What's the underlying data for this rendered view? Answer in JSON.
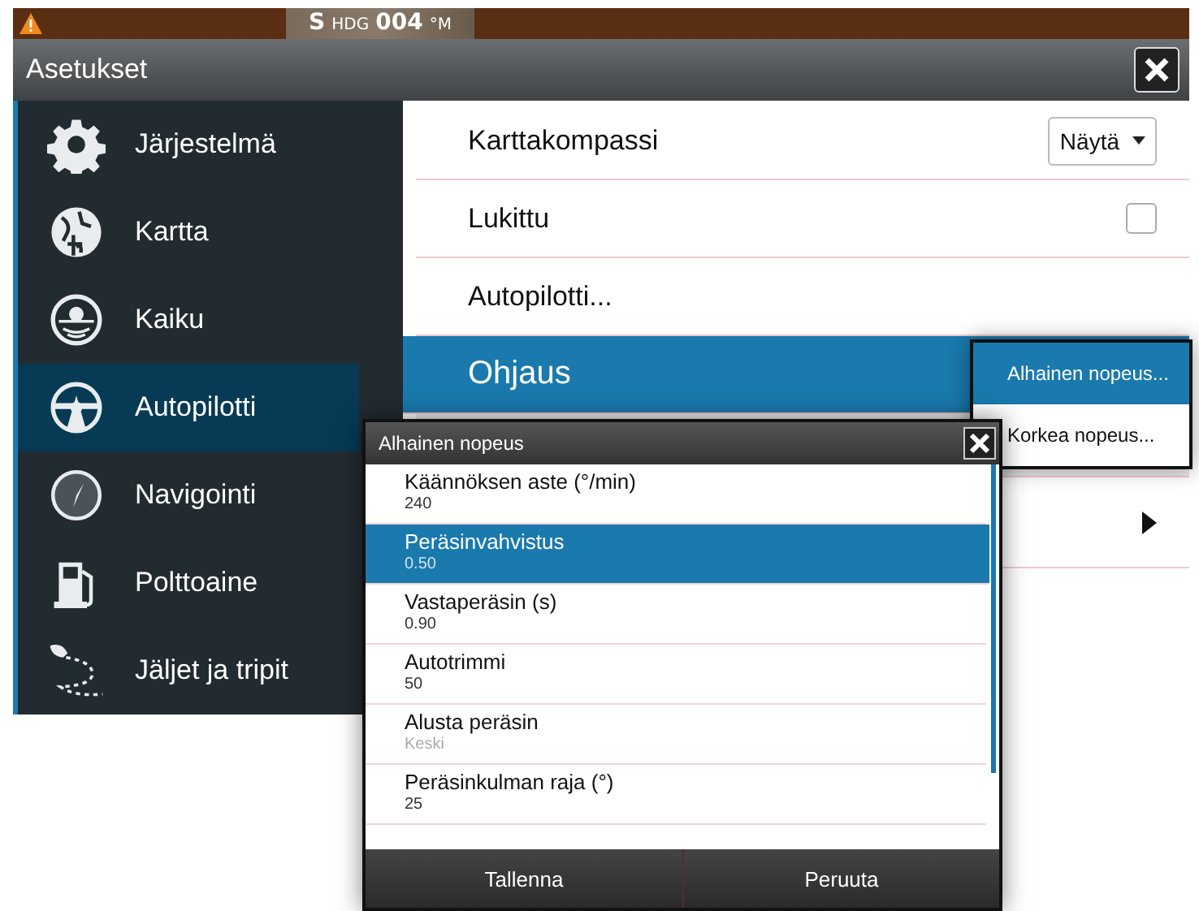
{
  "status_bar": {
    "warning": true,
    "heading": [
      {
        "kind": "main",
        "text": "S"
      },
      {
        "kind": "small",
        "text": "HDG"
      },
      {
        "kind": "main",
        "text": "004"
      },
      {
        "kind": "small",
        "text": "°M"
      }
    ]
  },
  "window": {
    "title": "Asetukset"
  },
  "sidebar": {
    "items": [
      {
        "label": "Järjestelmä",
        "kind": "gear",
        "selected": false
      },
      {
        "label": "Kartta",
        "kind": "chart",
        "selected": false
      },
      {
        "label": "Kaiku",
        "kind": "sonar",
        "selected": false
      },
      {
        "label": "Autopilotti",
        "kind": "wheel",
        "selected": true
      },
      {
        "label": "Navigointi",
        "kind": "compass",
        "selected": false
      },
      {
        "label": "Polttoaine",
        "kind": "fuel",
        "selected": false
      },
      {
        "label": "Jäljet ja tripit",
        "kind": "track",
        "selected": false
      }
    ]
  },
  "settings": [
    {
      "kind": "dropdown",
      "label": "Karttakompassi",
      "value": "Näytä",
      "selected": false
    },
    {
      "kind": "checkbox",
      "label": "Lukittu",
      "checked": false,
      "selected": false
    },
    {
      "kind": "link",
      "label": "Autopilotti...",
      "selected": false
    },
    {
      "kind": "link",
      "label": "Ohjaus",
      "selected": true
    },
    {
      "kind": "blank",
      "selected": false
    },
    {
      "kind": "arrow",
      "selected": false
    }
  ],
  "submenu": {
    "items": [
      {
        "label": "Alhainen nopeus...",
        "selected": true
      },
      {
        "label": "Korkea nopeus...",
        "selected": false
      }
    ]
  },
  "dialog": {
    "title": "Alhainen nopeus",
    "items": [
      {
        "label": "Käännöksen aste (°/min)",
        "value": "240",
        "selected": false,
        "disabled": false
      },
      {
        "label": "Peräsinvahvistus",
        "value": "0.50",
        "selected": true,
        "disabled": false
      },
      {
        "label": "Vastaperäsin (s)",
        "value": "0.90",
        "selected": false,
        "disabled": false
      },
      {
        "label": "Autotrimmi",
        "value": "50",
        "selected": false,
        "disabled": false
      },
      {
        "label": "Alusta peräsin",
        "value": "Keski",
        "selected": false,
        "disabled": true
      },
      {
        "label": "Peräsinkulman raja  (°)",
        "value": "25",
        "selected": false,
        "disabled": false
      }
    ],
    "buttons": [
      "Tallenna",
      "Peruuta"
    ]
  }
}
